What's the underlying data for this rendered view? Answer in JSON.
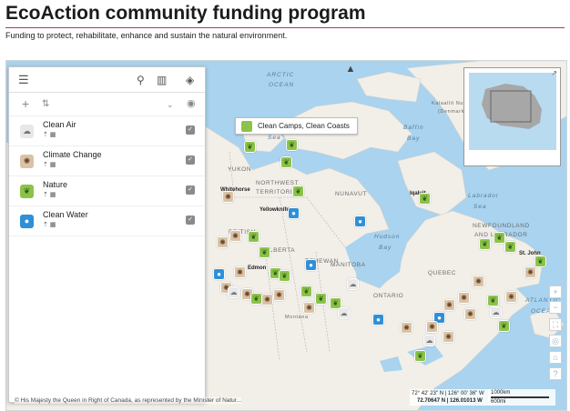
{
  "header": {
    "title": "EcoAction community funding program",
    "description": "Funding to protect, rehabilitate, enhance and sustain the natural environment."
  },
  "panel": {
    "layers": [
      {
        "name": "Clean Air",
        "type": "air",
        "icon": "cloud-icon",
        "sub": "⇡ ▦"
      },
      {
        "name": "Climate Change",
        "type": "climate",
        "icon": "globe-icon",
        "sub": "⇡ ▦"
      },
      {
        "name": "Nature",
        "type": "nature",
        "icon": "leaf-icon",
        "sub": "⇡ ▦"
      },
      {
        "name": "Clean Water",
        "type": "water",
        "icon": "water-drop-icon",
        "sub": "⇡ ▦"
      }
    ]
  },
  "map": {
    "tooltip": "Clean Camps, Clean Coasts",
    "water_labels": [
      "ARCTIC",
      "OCEAN",
      "Sea",
      "Baffin",
      "Bay",
      "Hudson",
      "Bay",
      "Labrador",
      "Sea",
      "ATLANTIC",
      "OCEA"
    ],
    "region_labels": [
      "YUKON",
      "NORTHWEST",
      "TERRITORIES",
      "NUNAVUT",
      "BRITISH",
      "ALBERTA",
      "TCHEWAN",
      "MANITOBA",
      "ONTARIO",
      "QUEBEC",
      "NEWFOUNDLAND",
      "AND LABRADOR",
      "Kalaallit Nunaat",
      "(Denmark)",
      "Montana"
    ],
    "city_labels": [
      "Whitehorse",
      "Yellowknife",
      "Iqaluit",
      "Edmon",
      "St. John"
    ],
    "coordinates": {
      "dms": "72° 42' 23\" N | 126° 00' 36\" W",
      "decimal": "72.70647 N | 126.01013 W"
    },
    "scale": {
      "top": "1000km",
      "bottom": "600mi"
    },
    "attribution": "© His Majesty the Queen in Right of Canada, as represented by the Minister of Natur..."
  },
  "colors": {
    "title_rule": "#af3c43",
    "water": "#a9d3ee",
    "land": "#f2efe9",
    "nature": "#8bc34a",
    "climate": "#d8c3a8",
    "water_marker": "#2f8fd8",
    "air": "#e8e8e8"
  }
}
